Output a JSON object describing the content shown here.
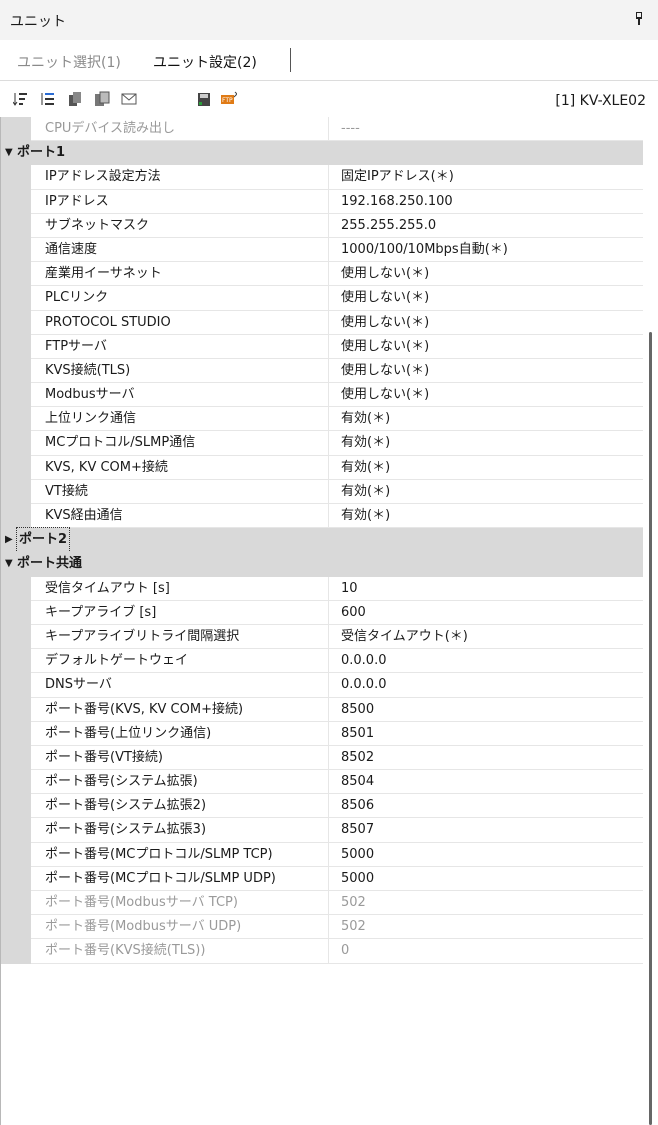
{
  "panel": {
    "title": "ユニット"
  },
  "tabs": [
    {
      "label": "ユニット選択(1)"
    },
    {
      "label": "ユニット設定(2)"
    }
  ],
  "toolbar": {
    "icons": [
      "sort-icon",
      "filter-icon",
      "copy-icon",
      "paste-icon",
      "mail-icon",
      "save-icon",
      "ftp-icon"
    ],
    "unit_name": "[1] KV-XLE02"
  },
  "rows": [
    {
      "kind": "item",
      "label": "CPUデバイス読み出し",
      "value": "----",
      "disabled": true
    },
    {
      "kind": "cat",
      "label": "ポート1",
      "expanded": true
    },
    {
      "kind": "item",
      "label": "IPアドレス設定方法",
      "value": "固定IPアドレス(＊)"
    },
    {
      "kind": "item",
      "label": "IPアドレス",
      "value": "192.168.250.100"
    },
    {
      "kind": "item",
      "label": "サブネットマスク",
      "value": "255.255.255.0"
    },
    {
      "kind": "item",
      "label": "通信速度",
      "value": "1000/100/10Mbps自動(＊)"
    },
    {
      "kind": "item",
      "label": "産業用イーサネット",
      "value": "使用しない(＊)"
    },
    {
      "kind": "item",
      "label": "PLCリンク",
      "value": "使用しない(＊)"
    },
    {
      "kind": "item",
      "label": "PROTOCOL STUDIO",
      "value": "使用しない(＊)"
    },
    {
      "kind": "item",
      "label": "FTPサーバ",
      "value": "使用しない(＊)"
    },
    {
      "kind": "item",
      "label": "KVS接続(TLS)",
      "value": "使用しない(＊)"
    },
    {
      "kind": "item",
      "label": "Modbusサーバ",
      "value": "使用しない(＊)"
    },
    {
      "kind": "item",
      "label": "上位リンク通信",
      "value": "有効(＊)"
    },
    {
      "kind": "item",
      "label": "MCプロトコル/SLMP通信",
      "value": "有効(＊)"
    },
    {
      "kind": "item",
      "label": "KVS, KV COM+接続",
      "value": "有効(＊)"
    },
    {
      "kind": "item",
      "label": "VT接続",
      "value": "有効(＊)"
    },
    {
      "kind": "item",
      "label": "KVS経由通信",
      "value": "有効(＊)"
    },
    {
      "kind": "cat",
      "label": "ポート2",
      "expanded": false,
      "focused": true
    },
    {
      "kind": "cat",
      "label": "ポート共通",
      "expanded": true
    },
    {
      "kind": "item",
      "label": "受信タイムアウト [s]",
      "value": "10"
    },
    {
      "kind": "item",
      "label": "キープアライブ [s]",
      "value": "600"
    },
    {
      "kind": "item",
      "label": "キープアライブリトライ間隔選択",
      "value": "受信タイムアウト(＊)"
    },
    {
      "kind": "item",
      "label": "デフォルトゲートウェイ",
      "value": "0.0.0.0"
    },
    {
      "kind": "item",
      "label": "DNSサーバ",
      "value": "0.0.0.0"
    },
    {
      "kind": "item",
      "label": "ポート番号(KVS, KV COM+接続)",
      "value": "8500"
    },
    {
      "kind": "item",
      "label": "ポート番号(上位リンク通信)",
      "value": "8501"
    },
    {
      "kind": "item",
      "label": "ポート番号(VT接続)",
      "value": "8502"
    },
    {
      "kind": "item",
      "label": "ポート番号(システム拡張)",
      "value": "8504"
    },
    {
      "kind": "item",
      "label": "ポート番号(システム拡張2)",
      "value": "8506"
    },
    {
      "kind": "item",
      "label": "ポート番号(システム拡張3)",
      "value": "8507"
    },
    {
      "kind": "item",
      "label": "ポート番号(MCプロトコル/SLMP TCP)",
      "value": "5000"
    },
    {
      "kind": "item",
      "label": "ポート番号(MCプロトコル/SLMP UDP)",
      "value": "5000"
    },
    {
      "kind": "item",
      "label": "ポート番号(Modbusサーバ TCP)",
      "value": "502",
      "disabled": true
    },
    {
      "kind": "item",
      "label": "ポート番号(Modbusサーバ UDP)",
      "value": "502",
      "disabled": true
    },
    {
      "kind": "item",
      "label": "ポート番号(KVS接続(TLS))",
      "value": "0",
      "disabled": true
    }
  ],
  "colors": {
    "category_bg": "#d9d9d9",
    "disabled_text": "#9a9a9a",
    "grid_line": "#e6e6e6"
  }
}
